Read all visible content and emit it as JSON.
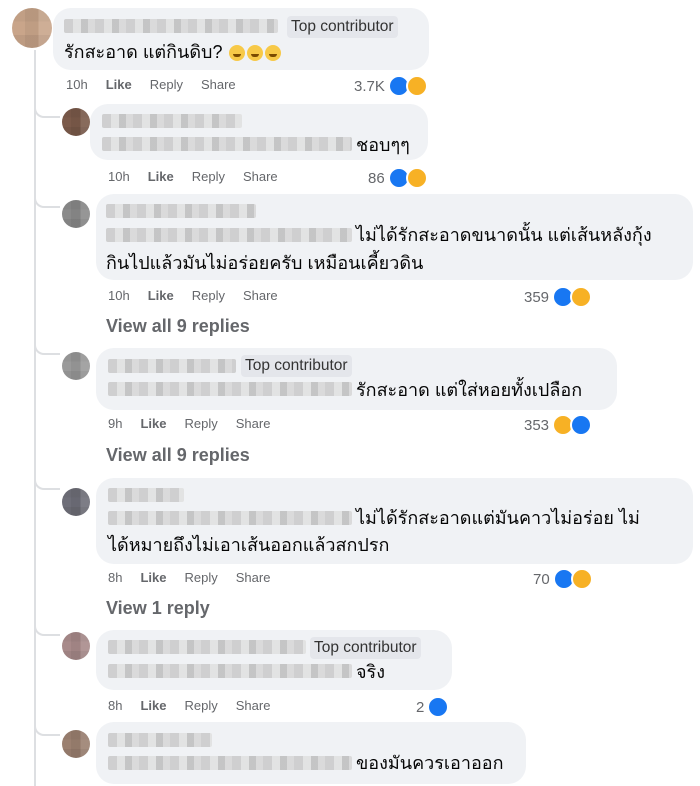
{
  "c1": {
    "badge": "Top contributor",
    "text": "รักสะอาด แต่กินดิบ?",
    "time": "10h",
    "count": "3.7K"
  },
  "r1": {
    "text": "ชอบๆๆ",
    "time": "10h",
    "count": "86"
  },
  "r2": {
    "line1": "ไม่ได้รักสะอาดขนาดนั้น แต่เส้นหลังกุ้ง",
    "line2": "กินไปแล้วมันไม่อร่อยครับ เหมือนเคี้ยวดิน",
    "time": "10h",
    "count": "359",
    "view": "View all 9 replies"
  },
  "r3": {
    "badge": "Top contributor",
    "text": "รักสะอาด แต่ใส่หอยทั้งเปลือก",
    "time": "9h",
    "count": "353",
    "view": "View all 9 replies"
  },
  "r4": {
    "line1": "ไม่ได้รักสะอาดแต่มันคาวไม่อร่อย ไม่",
    "line2": "ได้หมายถึงไม่เอาเส้นออกแล้วสกปรก",
    "time": "8h",
    "count": "70",
    "view": "View 1 reply"
  },
  "r5": {
    "badge": "Top contributor",
    "text": "จริง",
    "time": "8h",
    "count": "2"
  },
  "r6": {
    "text": "ของมันควรเอาออก"
  },
  "actions": {
    "like": "Like",
    "reply": "Reply",
    "share": "Share"
  }
}
